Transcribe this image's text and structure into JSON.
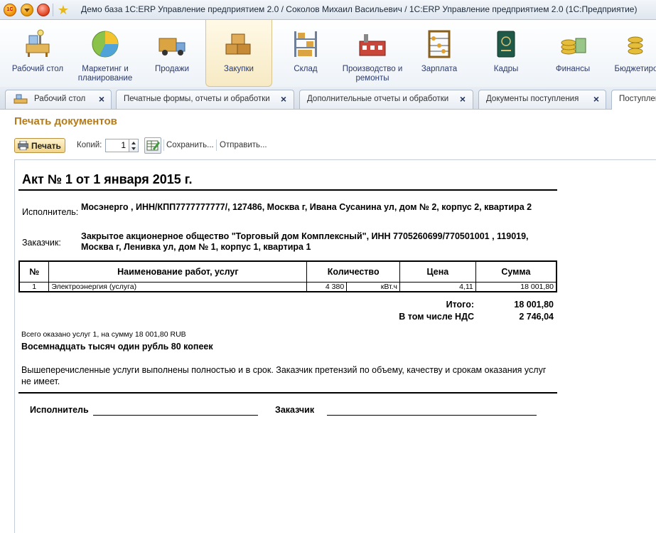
{
  "window": {
    "title": "Демо база 1С:ERP Управление предприятием 2.0 / Соколов Михаил Васильевич / 1С:ERP Управление предприятием 2.0  (1С:Предприятие)",
    "logo_text": "1С"
  },
  "sections": [
    {
      "label": "Рабочий стол",
      "icon": "desktop-icon"
    },
    {
      "label": "Маркетинг и планирование",
      "icon": "pie-chart-icon"
    },
    {
      "label": "Продажи",
      "icon": "truck-icon"
    },
    {
      "label": "Закупки",
      "icon": "boxes-icon"
    },
    {
      "label": "Склад",
      "icon": "warehouse-shelf-icon"
    },
    {
      "label": "Производство и ремонты",
      "icon": "factory-icon"
    },
    {
      "label": "Зарплата",
      "icon": "abacus-icon"
    },
    {
      "label": "Кадры",
      "icon": "passport-icon"
    },
    {
      "label": "Финансы",
      "icon": "coins-icon"
    },
    {
      "label": "Бюджетиров",
      "icon": "budget-coins-icon"
    }
  ],
  "open_tabs": [
    {
      "label": "Рабочий стол"
    },
    {
      "label": "Печатные формы, отчеты и обработки"
    },
    {
      "label": "Дополнительные отчеты и обработки"
    },
    {
      "label": "Документы поступления"
    },
    {
      "label": "Поступлен"
    }
  ],
  "form": {
    "title": "Печать документов",
    "print_label": "Печать",
    "copies_label": "Копий:",
    "copies_value": "1",
    "save_label": "Сохранить...",
    "send_label": "Отправить..."
  },
  "document": {
    "title": "Акт № 1 от 1 января 2015 г.",
    "executor_label": "Исполнитель:",
    "executor_value": "Мосэнерго , ИНН/КПП7777777777/, 127486, Москва г, Ивана Сусанина ул, дом № 2, корпус 2, квартира 2",
    "customer_label": "Заказчик:",
    "customer_value": "Закрытое акционерное общество \"Торговый дом Комплексный\", ИНН 7705260699/770501001 , 119019, Москва г, Ленивка ул, дом № 1, корпус 1, квартира 1",
    "table": {
      "headers": [
        "№",
        "Наименование работ, услуг",
        "Количество",
        "Цена",
        "Сумма"
      ],
      "rows": [
        {
          "num": "1",
          "name": "Электроэнергия (услуга)",
          "qty": "4 380",
          "unit": "кВт.ч",
          "price": "4,11",
          "sum": "18 001,80"
        }
      ]
    },
    "total_label": "Итого:",
    "total_value": "18 001,80",
    "vat_label": "В том числе НДС",
    "vat_value": "2 746,04",
    "summary_small": "Всего оказано услуг 1, на сумму 18 001,80 RUB",
    "summary_words": "Восемнадцать тысяч один рубль 80 копеек",
    "summary_note": "Вышеперечисленные услуги выполнены полностью и в срок. Заказчик претензий по объему, качеству и срокам оказания услуг не имеет.",
    "sign_executor": "Исполнитель",
    "sign_customer": "Заказчик"
  }
}
